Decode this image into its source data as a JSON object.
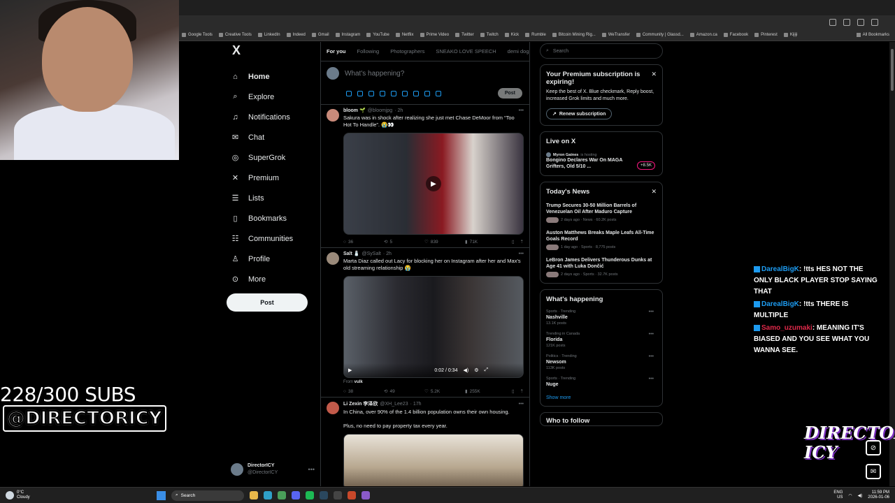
{
  "browser": {
    "bookmarks": [
      "Google Tools",
      "Creative Tools",
      "LinkedIn",
      "Indeed",
      "Gmail",
      "Instagram",
      "YouTube",
      "Netflix",
      "Prime Video",
      "Twitter",
      "Twitch",
      "Kick",
      "Rumble",
      "Bitcoin Mining Rig...",
      "WeTransfer",
      "Community | Glassd...",
      "Amazon.ca",
      "Facebook",
      "Pinterest",
      "Kijiji"
    ],
    "all_bookmarks": "All Bookmarks"
  },
  "stream": {
    "subs": "228/300 SUBS",
    "handle": "@DIRECTORICY",
    "logo": "DIRECTOR ICY"
  },
  "sidebar": {
    "logo": "X",
    "items": [
      {
        "label": "Home",
        "icon": "home-icon"
      },
      {
        "label": "Explore",
        "icon": "search-icon"
      },
      {
        "label": "Notifications",
        "icon": "bell-icon"
      },
      {
        "label": "Chat",
        "icon": "mail-icon"
      },
      {
        "label": "SuperGrok",
        "icon": "grok-icon"
      },
      {
        "label": "Premium",
        "icon": "x-icon"
      },
      {
        "label": "Lists",
        "icon": "list-icon"
      },
      {
        "label": "Bookmarks",
        "icon": "bookmark-icon"
      },
      {
        "label": "Communities",
        "icon": "people-icon"
      },
      {
        "label": "Profile",
        "icon": "person-icon"
      },
      {
        "label": "More",
        "icon": "more-circle-icon"
      }
    ],
    "post_label": "Post",
    "account": {
      "name": "DirectorICY",
      "handle": "@DirectorICY"
    }
  },
  "feed": {
    "tabs": [
      "For you",
      "Following",
      "Photographers",
      "SNEAKO LOVE SPEECH",
      "demi dog"
    ],
    "composer_placeholder": "What's happening?",
    "composer_post": "Post",
    "tweets": [
      {
        "name": "bloom 🌱",
        "handle": "@bloomjpg",
        "time": "· 2h",
        "text": "Sakura was in shock after realizing she just met Chase DeMoor from “Too Hot To Handle”. 😭👀",
        "replies": "36",
        "reposts": "5",
        "likes": "839",
        "views": "71K"
      },
      {
        "name": "Salt 🧂",
        "handle": "@SySalt",
        "time": "· 2h",
        "text": "Marta Diaz called out Lacy for blocking her on Instagram after her and Max's old streaming relationship 😭",
        "video_time": "0:02 / 0:34",
        "from_label": "From",
        "from_name": "vulk",
        "replies": "38",
        "reposts": "49",
        "likes": "5.2K",
        "views": "255K"
      },
      {
        "name": "Li Zexin 李泽欣",
        "handle": "@XH_Lee23",
        "time": "· 17h",
        "text": "In China, over 90% of the 1.4 billion population owns their own housing.",
        "text2": "Plus, no need to pay property tax every year."
      }
    ]
  },
  "right": {
    "search_placeholder": "Search",
    "premium": {
      "title": "Your Premium subscription is expiring!",
      "body": "Keep the best of X. Blue checkmark, Reply boost, increased Grok limits and much more.",
      "button": "Renew subscription"
    },
    "live": {
      "title": "Live on X",
      "host": "Myron Gaines",
      "host_suffix": "is hosting",
      "stream_title": "Bongino Declares War On MAGA Grifters, Old 5/10 ...",
      "count": "+8.5K"
    },
    "news": {
      "title": "Today's News",
      "items": [
        {
          "title": "Trump Secures 30-50 Million Barrels of Venezuelan Oil After Maduro Capture",
          "meta": "2 days ago · News · 60.2K posts"
        },
        {
          "title": "Auston Matthews Breaks Maple Leafs All-Time Goals Record",
          "meta": "1 day ago · Sports · 8,775 posts"
        },
        {
          "title": "LeBron James Delivers Thunderous Dunks at Age 41 with Luka Dončić",
          "meta": "2 days ago · Sports · 32.7K posts"
        }
      ]
    },
    "happening": {
      "title": "What's happening",
      "trends": [
        {
          "ctx": "Sports · Trending",
          "name": "Nashville",
          "count": "13.1K posts"
        },
        {
          "ctx": "Trending in Canada",
          "name": "Florida",
          "count": "121K posts"
        },
        {
          "ctx": "Politics · Trending",
          "name": "Newsom",
          "count": "113K posts"
        },
        {
          "ctx": "Sports · Trending",
          "name": "Nuge",
          "count": ""
        }
      ],
      "show_more": "Show more"
    },
    "who_to_follow": "Who to follow"
  },
  "chat": [
    {
      "user": "DarealBigK",
      "text": ": !tts HES NOT THE ONLY BLACK PLAYER STOP SAYING THAT",
      "color": "#1d9bf0"
    },
    {
      "user": "DarealBigK",
      "text": ": !tts THERE IS MULTIPLE",
      "color": "#1d9bf0"
    },
    {
      "user": "Samo_uzumaki",
      "text": ": MEANING IT'S BIASED AND YOU SEE WHAT YOU WANNA SEE.",
      "color": "#e0294a"
    }
  ],
  "taskbar": {
    "temp": "0°C",
    "condition": "Cloudy",
    "search": "Search",
    "lang1": "ENG",
    "lang2": "US",
    "time": "11:59 PM",
    "date": "2026-01-06"
  }
}
